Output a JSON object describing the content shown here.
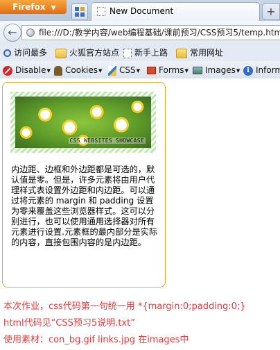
{
  "browser": {
    "app_menu_label": "Firefox",
    "tab_title": "New Document",
    "new_tab_label": "+",
    "url": "file:///D:/教学内容/web编程基础/课前预习/CSS预习5/temp.htm",
    "back_label": "←"
  },
  "bookmarks": [
    {
      "label": "访问最多",
      "icon": "search-icon"
    },
    {
      "label": "火狐官方站点",
      "icon": "folder-icon"
    },
    {
      "label": "新手上路",
      "icon": "page-icon"
    },
    {
      "label": "常用网址",
      "icon": "folder-icon"
    }
  ],
  "webdev_toolbar": [
    {
      "label": "Disable",
      "icon": "disable-icon"
    },
    {
      "label": "Cookies",
      "icon": "cookie-icon"
    },
    {
      "label": "CSS",
      "icon": "css-icon"
    },
    {
      "label": "Forms",
      "icon": "forms-icon"
    },
    {
      "label": "Images",
      "icon": "images-icon"
    },
    {
      "label": "Inform",
      "icon": "info-icon"
    }
  ],
  "page": {
    "banner_text": "CSS WEBSITES SHOWCASE",
    "description": "内边距、边框和外边距都是可选的，默认值是零。但是，许多元素将由用户代理样式表设置外边距和内边距。可以通过将元素的 margin 和 padding 设置为零来覆盖这些浏览器样式。这可以分别进行，也可以使用通用选择器对所有元素进行设置.元素框的最内部分是实际的内容，直接包围内容的是内边距。",
    "notes": [
      "本次作业，css代码第一句统一用 *{margin:0;padding:0;}",
      "html代码见“CSS预习5说明.txt”",
      "使用素材：con_bg.gif   links.jpg 在images中"
    ]
  },
  "colors": {
    "card_border": "#f0a41f",
    "notes_text": "#e43a3a",
    "banner_stripe": "#b9e9a7"
  }
}
